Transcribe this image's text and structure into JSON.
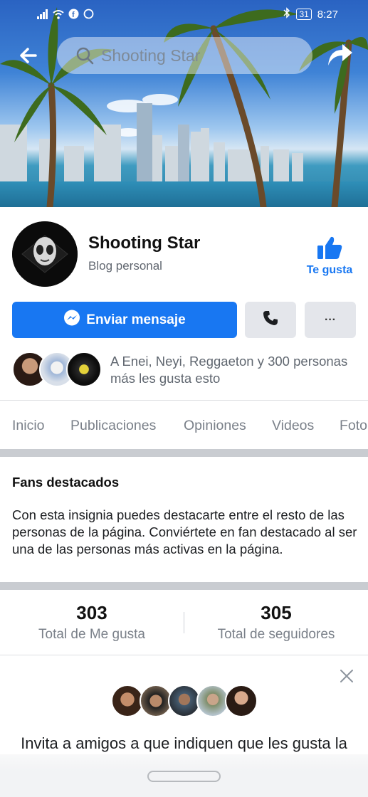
{
  "status_bar": {
    "time": "8:27",
    "battery": "31",
    "icons": [
      "signal-icon",
      "wifi-icon",
      "facebook-icon",
      "whatsapp-icon",
      "bluetooth-icon",
      "battery-icon"
    ]
  },
  "top_bar": {
    "search_text": "Shooting Star",
    "back_icon": "back-arrow-icon",
    "share_icon": "share-icon"
  },
  "page": {
    "name": "Shooting Star",
    "category": "Blog personal",
    "like_label": "Te gusta"
  },
  "actions": {
    "message_label": "Enviar mensaje",
    "call_icon": "phone-icon",
    "more_label": "···"
  },
  "likes_summary": "A Enei, Neyi, Reggaeton y 300 personas más les gusta esto",
  "tabs": [
    "Inicio",
    "Publicaciones",
    "Opiniones",
    "Videos",
    "Foto"
  ],
  "fans": {
    "title": "Fans destacados",
    "description": "Con esta insignia puedes destacarte entre el resto de las personas de la página. Conviértete en fan destacado al ser una de las personas más activas en la página."
  },
  "stats": [
    {
      "value": "303",
      "label": "Total de Me gusta"
    },
    {
      "value": "305",
      "label": "Total de seguidores"
    }
  ],
  "invite": {
    "text": "Invita a amigos a que indiquen que les gusta la"
  },
  "colors": {
    "accent": "#1877f2",
    "button_gray": "#e4e6eb",
    "muted_text": "#7a8089"
  }
}
